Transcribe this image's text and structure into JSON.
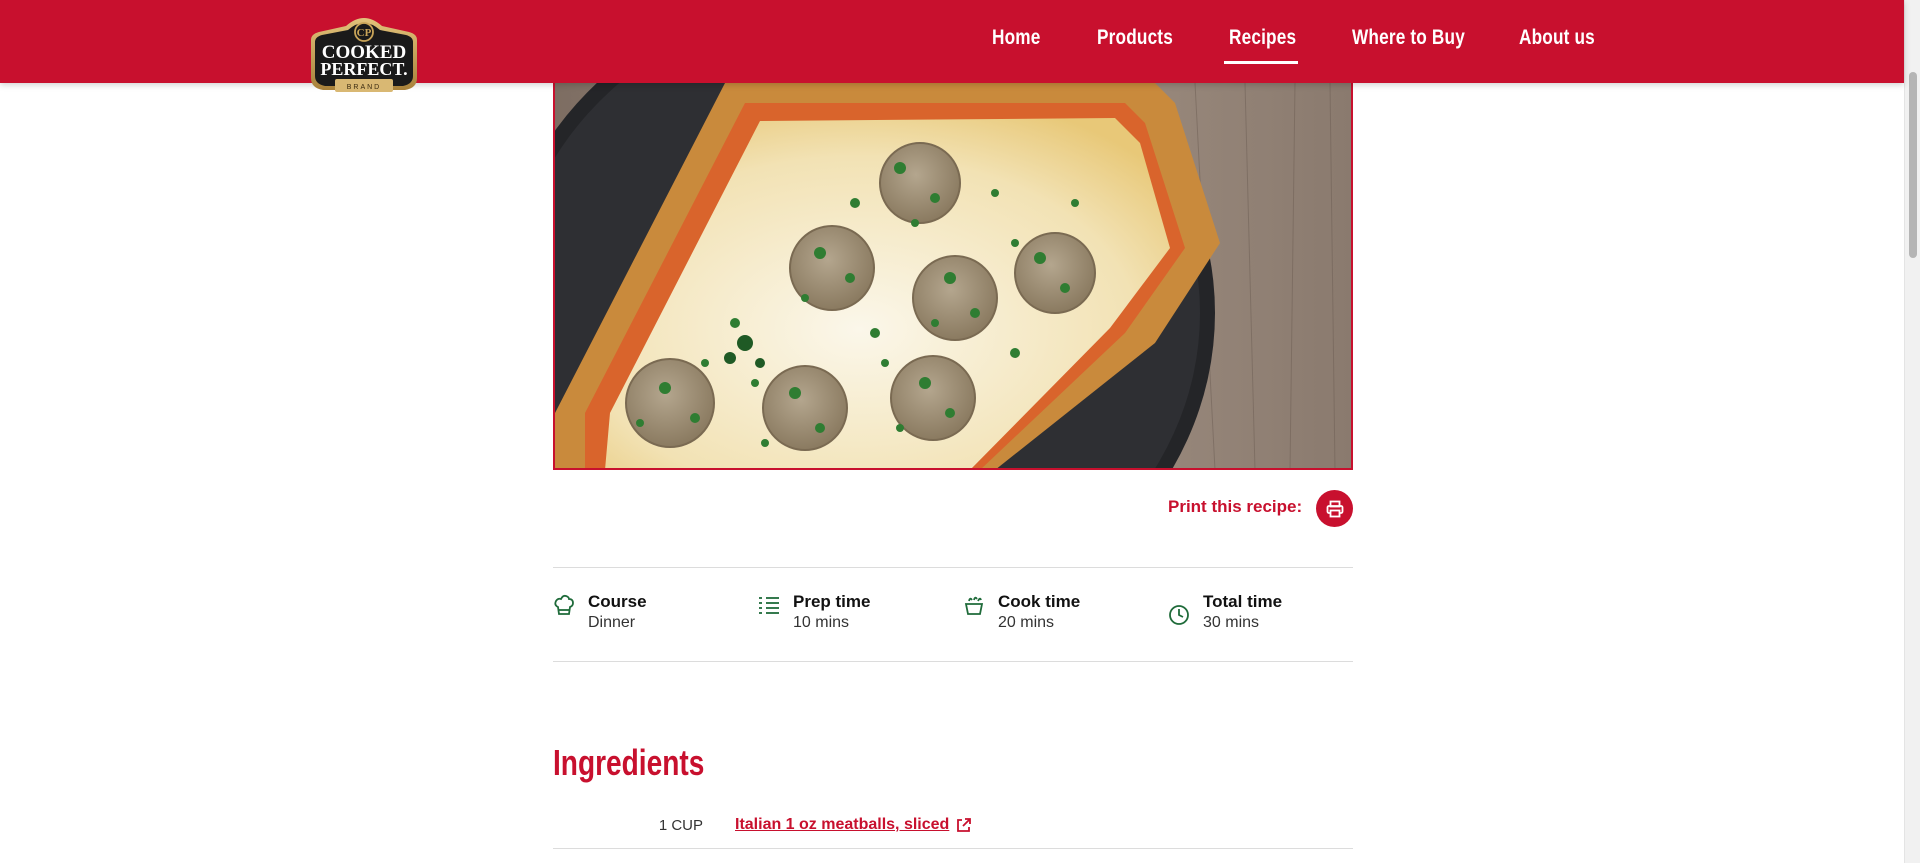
{
  "header": {
    "brand": "Cooked Perfect Brand",
    "logo_line1": "COOKED",
    "logo_line2": "PERFECT.",
    "logo_line3": "BRAND",
    "nav": [
      {
        "label": "Home",
        "active": false
      },
      {
        "label": "Products",
        "active": false
      },
      {
        "label": "Recipes",
        "active": true
      },
      {
        "label": "Where to Buy",
        "active": false
      },
      {
        "label": "About us",
        "active": false
      }
    ]
  },
  "recipe": {
    "print_label": "Print this recipe:",
    "print_icon": "printer-icon",
    "meta": [
      {
        "title": "Course",
        "value": "Dinner",
        "icon": "chef-hat-icon"
      },
      {
        "title": "Prep time",
        "value": "10 mins",
        "icon": "list-icon"
      },
      {
        "title": "Cook time",
        "value": "20 mins",
        "icon": "pot-icon"
      },
      {
        "title": "Total time",
        "value": "30 mins",
        "icon": "clock-icon"
      }
    ]
  },
  "ingredients": {
    "title": "Ingredients",
    "items": [
      {
        "qty": "1 CUP",
        "name": "Italian 1 oz meatballs, sliced",
        "icon": "external-link-icon"
      }
    ]
  },
  "colors": {
    "brand_red": "#c8102e",
    "icon_green": "#1f6b3a"
  }
}
